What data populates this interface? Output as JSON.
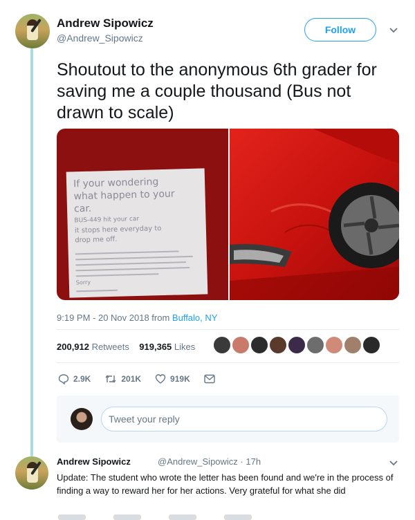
{
  "author": {
    "name": "Andrew Sipowicz",
    "handle": "@Andrew_Sipowicz"
  },
  "follow_label": "Follow",
  "tweet_text": "Shoutout to the anonymous 6th grader for saving me a couple thousand (Bus not drawn to scale)",
  "note_lines": [
    "If your wondering",
    "what happen to your",
    "car.",
    "BUS-449 hit your car",
    "it stops here everyday to",
    "drop me off.",
    "Sorry"
  ],
  "meta": {
    "time": "9:19 PM - 20 Nov 2018 from ",
    "location": "Buffalo, NY"
  },
  "stats": {
    "retweets_count": "200,912",
    "retweets_label": "Retweets",
    "likes_count": "919,365",
    "likes_label": "Likes"
  },
  "liker_colors": [
    "#3a3a3a",
    "#c97a6a",
    "#2d2d2d",
    "#5a3a2a",
    "#3c2a4a",
    "#6d6d6d",
    "#d08a78",
    "#a0806a",
    "#2a2a2a"
  ],
  "actions": {
    "replies": "2.9K",
    "retweets": "201K",
    "likes": "919K"
  },
  "reply_placeholder": "Tweet your reply",
  "reply_tweet": {
    "name": "Andrew Sipowicz",
    "handle": "@Andrew_Sipowicz · 17h",
    "text": "Update: The student who wrote the letter has been found and we're in the process of finding a way to reward her for her actions. Very grateful for what she did"
  },
  "colors": {
    "accent": "#1da1f2",
    "thread_line": "#a8dde0",
    "muted": "#657786"
  }
}
